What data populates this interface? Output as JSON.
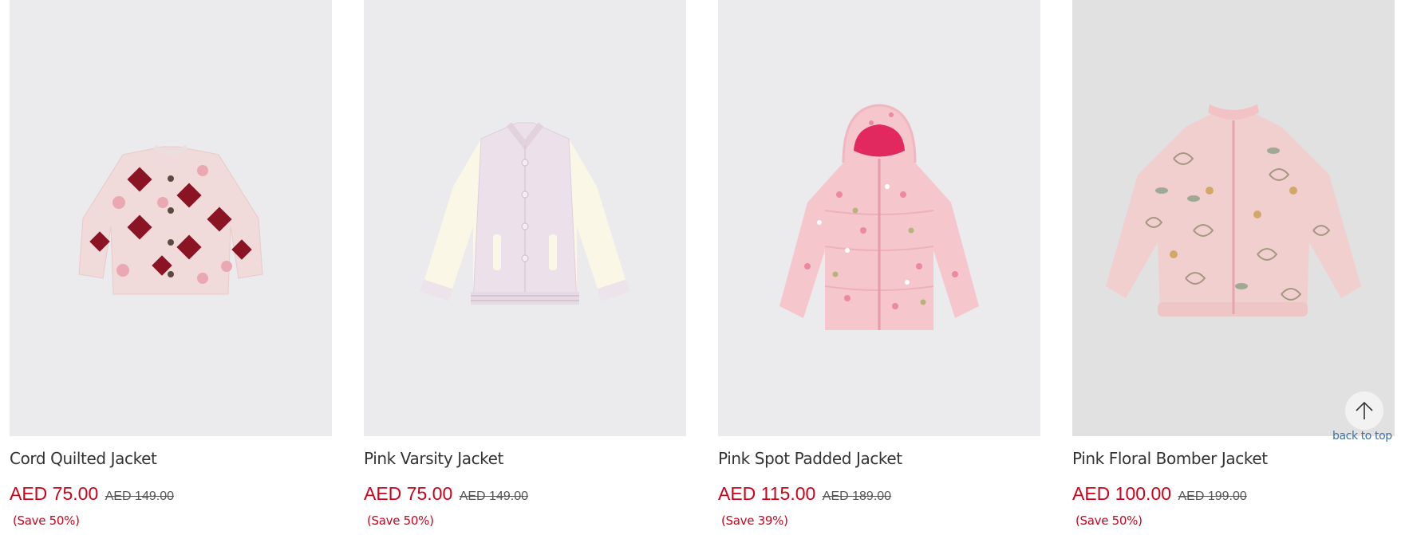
{
  "products": [
    {
      "name": "Cord Quilted Jacket",
      "price": "AED 75.00",
      "was": "AED 149.00",
      "save": "(Save 50%)",
      "image_icon": "quilted-jacket-icon",
      "bg": "#ebebed"
    },
    {
      "name": "Pink Varsity Jacket",
      "price": "AED 75.00",
      "was": "AED 149.00",
      "save": "(Save 50%)",
      "image_icon": "varsity-jacket-icon",
      "bg": "#ebebed"
    },
    {
      "name": "Pink Spot Padded Jacket",
      "price": "AED 115.00",
      "was": "AED 189.00",
      "save": "(Save 39%)",
      "image_icon": "padded-jacket-icon",
      "bg": "#ebebed"
    },
    {
      "name": "Pink Floral Bomber Jacket",
      "price": "AED 100.00",
      "was": "AED 199.00",
      "save": "(Save 50%)",
      "image_icon": "bomber-jacket-icon",
      "bg": "#e1e1e1"
    }
  ],
  "back_to_top": {
    "label": "back to top",
    "icon": "arrow-up-icon"
  },
  "colors": {
    "sale_price": "#d0021b",
    "link": "#3a6fa6"
  }
}
